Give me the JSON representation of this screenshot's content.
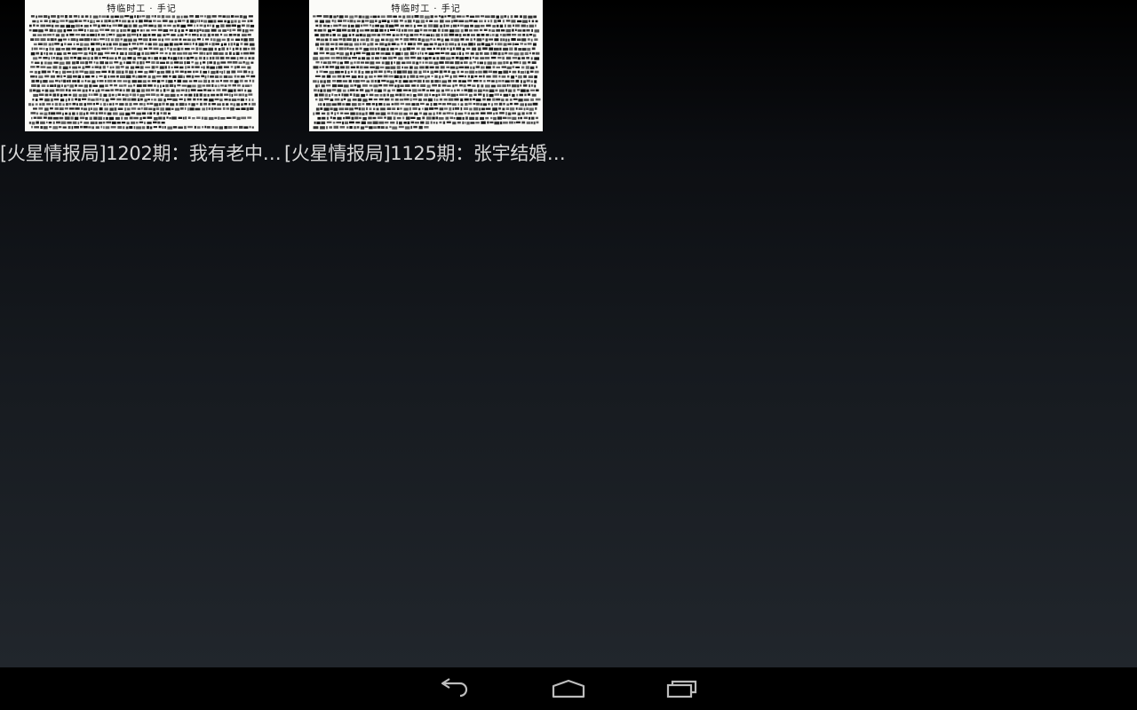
{
  "gallery": {
    "items": [
      {
        "caption": "[火星情报局]1202期：我有老中…",
        "thumbnail_title": "特临时工 · 手记"
      },
      {
        "caption": "[火星情报局]1125期：张宇结婚…",
        "thumbnail_title": "特临时工 · 手记"
      }
    ]
  },
  "navbar": {
    "buttons": [
      {
        "icon": "back-icon"
      },
      {
        "icon": "home-icon"
      },
      {
        "icon": "recent-apps-icon"
      }
    ]
  },
  "colors": {
    "caption_text": "#d9d9d9",
    "nav_icon": "#bdbdbd",
    "thumbnail_bg": "#fbfbf8"
  }
}
